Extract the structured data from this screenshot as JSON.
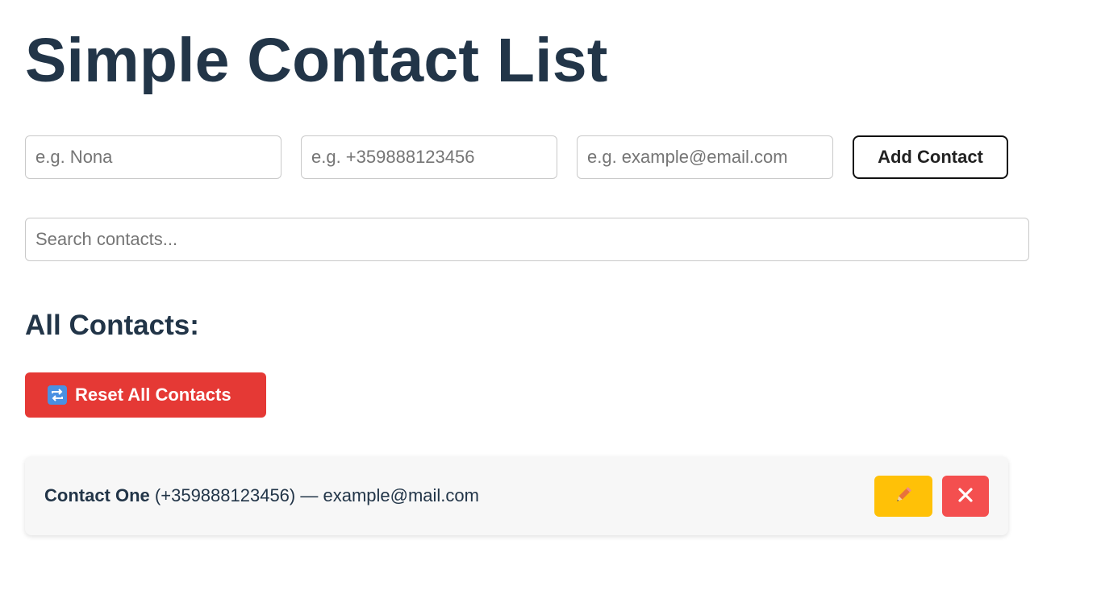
{
  "header": {
    "title": "Simple Contact List"
  },
  "form": {
    "name_placeholder": "e.g. Nona",
    "phone_placeholder": "e.g. +359888123456",
    "email_placeholder": "e.g. example@email.com",
    "add_label": "Add Contact"
  },
  "search": {
    "placeholder": "Search contacts..."
  },
  "contacts_section": {
    "heading": "All Contacts:",
    "reset_label": "Reset All Contacts",
    "reset_icon": "repeat-icon",
    "items": [
      {
        "name": "Contact One",
        "phone": "(+359888123456)",
        "separator": " — ",
        "email": "example@mail.com",
        "edit_icon": "pencil-icon",
        "delete_icon": "close-icon"
      }
    ]
  },
  "colors": {
    "heading": "#223548",
    "reset_button": "#e53935",
    "edit_button": "#ffc107",
    "delete_button": "#f44f4f"
  }
}
